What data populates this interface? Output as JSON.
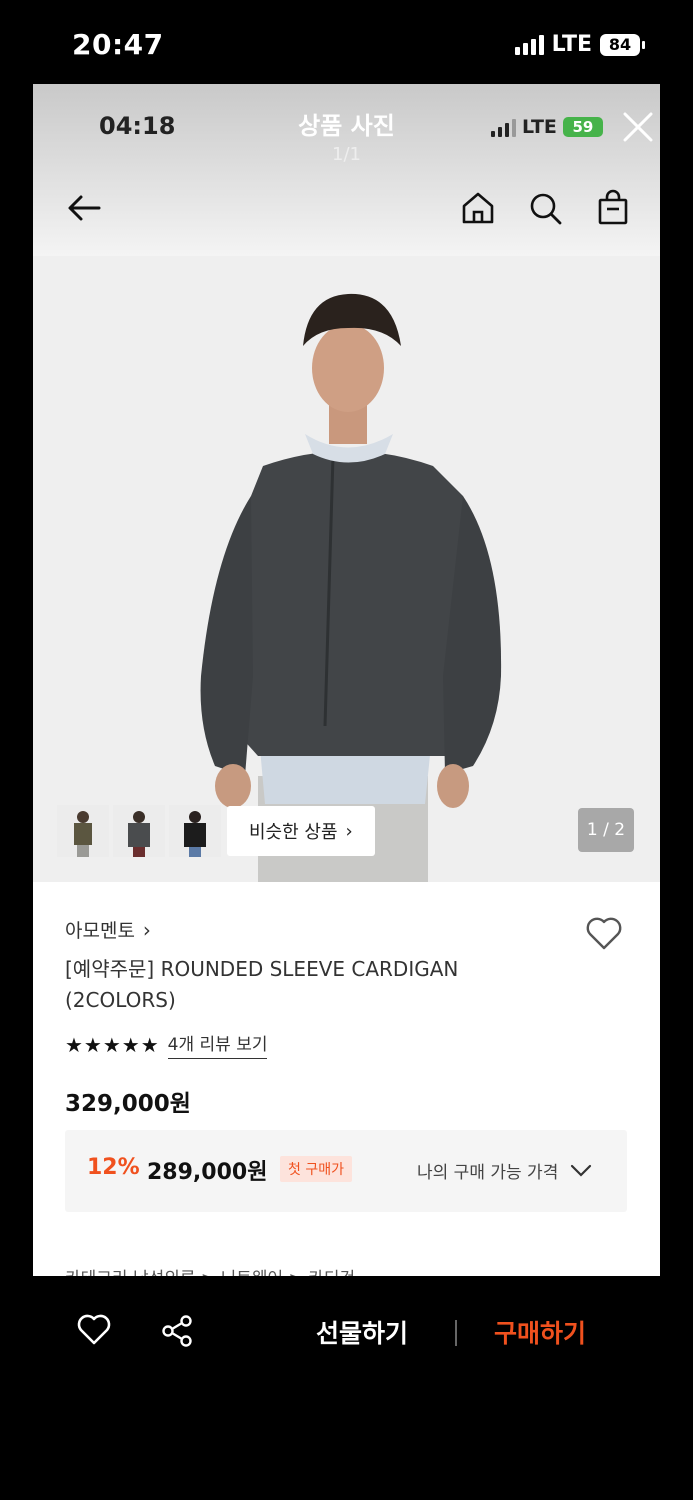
{
  "device_status": {
    "time": "20:47",
    "network": "LTE",
    "battery": "84"
  },
  "viewer": {
    "status_time": "04:18",
    "status_network": "LTE",
    "status_battery": "59",
    "title": "상품 사진",
    "counter": "1/1"
  },
  "header": {
    "back_icon": "arrow-left-icon",
    "icons": [
      "home-icon",
      "search-icon",
      "shopping-bag-icon"
    ]
  },
  "gallery": {
    "similar_label": "비슷한 상품",
    "page_indicator": "1 / 2",
    "thumbnail_count": 3
  },
  "product": {
    "brand": "아모멘토",
    "name": "[예약주문] ROUNDED SLEEVE CARDIGAN (2COLORS)",
    "stars": "★★★★★",
    "rating_value": 5,
    "review_link": "4개 리뷰 보기",
    "original_price": "329,000원",
    "discount_rate": "12%",
    "discount_price": "289,000원",
    "first_purchase_badge": "첫 구매가",
    "my_price_label": "나의 구매 가능 가격",
    "category_partial": "카테고리       남성의류 > 니트웨어 > 카디건"
  },
  "bottom_bar": {
    "gift_label": "선물하기",
    "buy_label": "구매하기"
  },
  "colors": {
    "accent": "#f0511e",
    "panel_bg": "#ffffff",
    "outer_bg": "#000000"
  }
}
